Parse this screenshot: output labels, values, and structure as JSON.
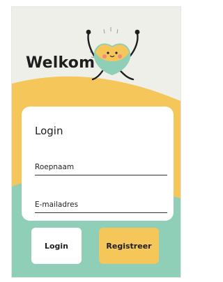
{
  "header": {
    "title": "Welkom"
  },
  "login_card": {
    "title": "Login",
    "fields": [
      {
        "placeholder": "Roepnaam",
        "value": ""
      },
      {
        "placeholder": "E-mailadres",
        "value": ""
      }
    ]
  },
  "actions": {
    "login_label": "Login",
    "register_label": "Registreer"
  },
  "colors": {
    "background": "#efefea",
    "accent_yellow": "#f5c65a",
    "accent_green": "#8fcfb7",
    "text": "#1e1e1e"
  },
  "icons": {
    "mascot": "heart-mascot-icon"
  }
}
